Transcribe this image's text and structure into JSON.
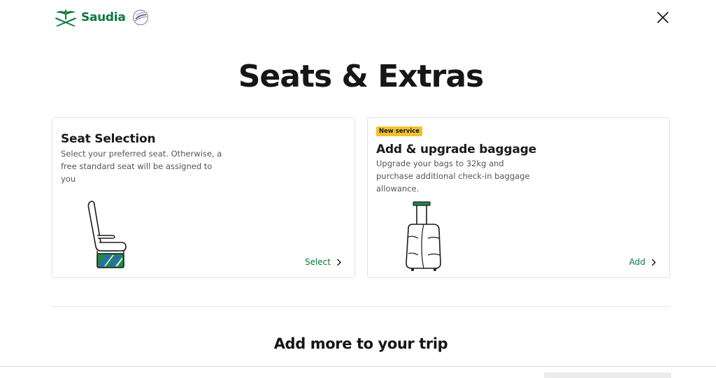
{
  "brand": {
    "name": "Saudia",
    "color": "#0b7a3b"
  },
  "header": {
    "logo_icon": "saudia-palm-swords-icon",
    "alliance_icon": "skyteam-icon",
    "close_icon": "close-icon"
  },
  "page_title": "Seats & Extras",
  "cards": [
    {
      "title": "Seat Selection",
      "description": "Select your preferred seat. Otherwise, a free standard seat will be assigned to you",
      "action_label": "Select",
      "illustration": "seat-icon"
    },
    {
      "badge": "New service",
      "title": "Add & upgrade baggage",
      "description": "Upgrade your bags to 32kg and purchase additional check-in baggage allowance.",
      "action_label": "Add",
      "illustration": "suitcase-icon"
    }
  ],
  "section_title": "Add more to your trip",
  "colors": {
    "badge": "#f2c12e",
    "link": "#0b7a3b"
  }
}
